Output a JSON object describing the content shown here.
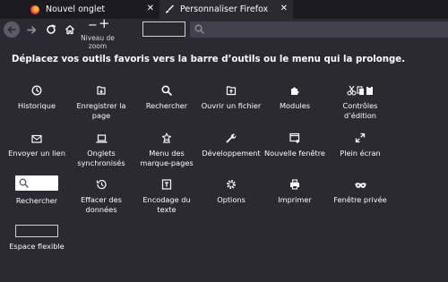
{
  "tabs": [
    {
      "label": "Nouvel onglet",
      "icon": "firefox-icon",
      "close_label": "✕"
    },
    {
      "label": "Personnaliser Firefox",
      "icon": "paintbrush-icon",
      "close_label": "✕"
    }
  ],
  "toolbar": {
    "zoom_minus": "−",
    "zoom_plus": "+",
    "zoom_label": "Niveau de zoom"
  },
  "heading": "Déplacez vos outils favoris vers la barre d’outils ou le menu qui la prolonge.",
  "palette": {
    "history": "Historique",
    "save_page": "Enregistrer la page",
    "search": "Rechercher",
    "open_file": "Ouvrir un fichier",
    "addons": "Modules",
    "edit_controls": "Contrôles d’édition",
    "email_link": "Envoyer un lien",
    "synced_tabs": "Onglets synchronisés",
    "bookmarks_menu": "Menu des marque-pages",
    "developer": "Développement",
    "new_window": "Nouvelle fenêtre",
    "fullscreen": "Plein écran",
    "search_box": "Rechercher",
    "forget": "Effacer des données",
    "text_encoding": "Encodage du texte",
    "options": "Options",
    "print": "Imprimer",
    "private_window": "Fenêtre privée",
    "flexible_space": "Espace flexible"
  },
  "colors": {
    "background": "#2b2a33",
    "tabstrip": "#1c1b22",
    "text": "#fbfbfe",
    "urlbar": "#42414d"
  }
}
